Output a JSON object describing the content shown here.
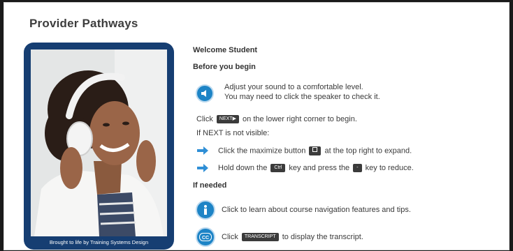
{
  "page": {
    "title": "Provider Pathways"
  },
  "photo": {
    "caption": "Brought to life by Training Systems Design"
  },
  "content": {
    "welcome": "Welcome Student",
    "before_heading": "Before you begin",
    "sound_line1": "Adjust your sound to a comfortable level.",
    "sound_line2": "You may need to click the speaker to check it.",
    "click_prefix": "Click",
    "next_button": "NEXT▶",
    "click_suffix": "on the lower right corner to begin.",
    "if_next": "If NEXT is not visible:",
    "maximize_prefix": "Click the maximize button",
    "maximize_suffix": "at the top right to expand.",
    "hold_prefix": "Hold down the",
    "ctrl_key": "Ctrl",
    "hold_middle": "key and press the",
    "minus_key": "-",
    "hold_suffix": "key to reduce.",
    "if_needed": "If needed",
    "info_text": "Click to learn about course navigation features and tips.",
    "transcript_prefix": "Click",
    "transcript_button": "TRANSCRIPT",
    "transcript_suffix": "to display the transcript."
  },
  "icons": {
    "speaker": "speaker-icon",
    "info": "info-icon",
    "cc": "cc-icon",
    "arrow": "arrow-right-icon",
    "maximize": "maximize-icon"
  },
  "colors": {
    "accent": "#1d84c6",
    "card": "#163e72",
    "button": "#3b3b3b"
  }
}
